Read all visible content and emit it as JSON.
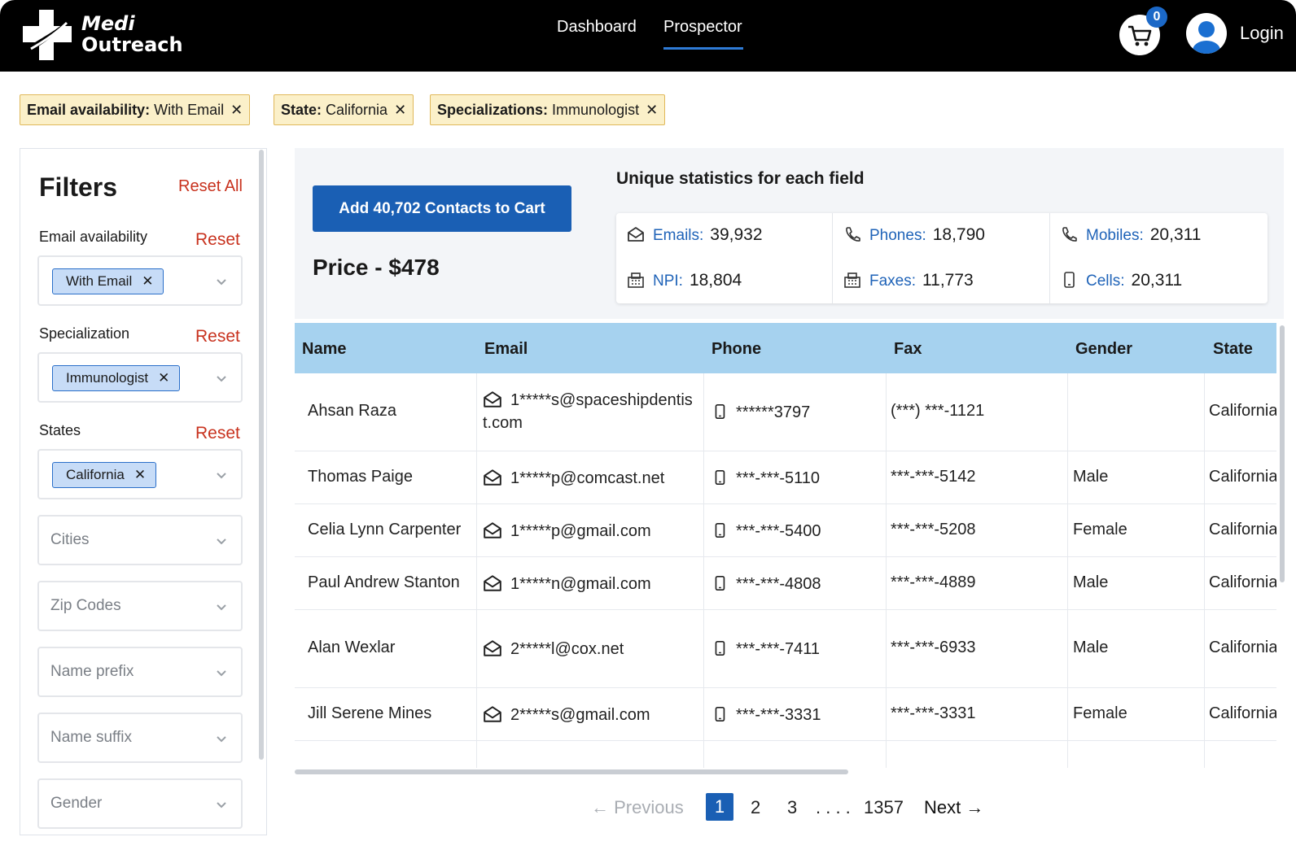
{
  "header": {
    "logo_line1": "Medi",
    "logo_line2": "Outreach",
    "nav": [
      "Dashboard",
      "Prospector"
    ],
    "active_nav": "Prospector",
    "cart_count": "0",
    "login_label": "Login"
  },
  "chips": [
    {
      "key": "Email availability:",
      "value": " With Email"
    },
    {
      "key": "State:",
      "value": " California"
    },
    {
      "key": "Specializations:",
      "value": " Immunologist"
    }
  ],
  "sidebar": {
    "title": "Filters",
    "reset_all": "Reset All",
    "reset_label": "Reset",
    "email_label": "Email availability",
    "email_tag": "With Email",
    "spec_label": "Specialization",
    "spec_tag": "Immunologist",
    "states_label": "States",
    "states_tag": "California",
    "placeholders": [
      "Cities",
      "Zip Codes",
      "Name prefix",
      "Name suffix",
      "Gender"
    ]
  },
  "summary": {
    "add_button": "Add 40,702 Contacts to Cart",
    "price": "Price - $478",
    "stats_title": "Unique statistics for each field",
    "stats": [
      {
        "label": "Emails:",
        "value": "39,932",
        "icon": "envelope-icon"
      },
      {
        "label": "Phones:",
        "value": "18,790",
        "icon": "phone-icon"
      },
      {
        "label": "Mobiles:",
        "value": "20,311",
        "icon": "phone-icon"
      },
      {
        "label": "NPI:",
        "value": "18,804",
        "icon": "fax-icon"
      },
      {
        "label": "Faxes:",
        "value": "11,773",
        "icon": "fax-icon"
      },
      {
        "label": "Cells:",
        "value": "20,311",
        "icon": "mobile-icon"
      }
    ]
  },
  "table": {
    "columns": [
      "Name",
      "Email",
      "Phone",
      "Fax",
      "Gender",
      "State"
    ],
    "rows": [
      {
        "name": "Ahsan Raza",
        "email_l1": "1*****s@spaceshipdentis",
        "email_l2": "t.com",
        "phone": "******3797",
        "fax": "(***) ***-1121",
        "gender": "",
        "state": "California"
      },
      {
        "name": "Thomas Paige",
        "email_l1": "1*****p@comcast.net",
        "email_l2": "",
        "phone": "***-***-5110",
        "fax": "***-***-5142",
        "gender": "Male",
        "state": "California"
      },
      {
        "name": "Celia Lynn Carpenter",
        "email_l1": "1*****p@gmail.com",
        "email_l2": "",
        "phone": "***-***-5400",
        "fax": "***-***-5208",
        "gender": "Female",
        "state": "California"
      },
      {
        "name": "Paul Andrew Stanton",
        "email_l1": "1*****n@gmail.com",
        "email_l2": "",
        "phone": "***-***-4808",
        "fax": "***-***-4889",
        "gender": "Male",
        "state": "California"
      },
      {
        "name": "Alan Wexlar",
        "email_l1": "2*****l@cox.net",
        "email_l2": "",
        "phone": "***-***-7411",
        "fax": "***-***-6933",
        "gender": "Male",
        "state": "California"
      },
      {
        "name": "Jill Serene Mines",
        "email_l1": "2*****s@gmail.com",
        "email_l2": "",
        "phone": "***-***-3331",
        "fax": "***-***-3331",
        "gender": "Female",
        "state": "California"
      }
    ]
  },
  "pagination": {
    "previous": "Previous",
    "pages": [
      "1",
      "2",
      "3"
    ],
    "ellipsis": ". . . .",
    "last": "1357",
    "next": "Next",
    "current": "1"
  },
  "colors": {
    "brand_blue": "#1a5fb4",
    "header_bg": "#000000",
    "table_header_bg": "#a6d2ef",
    "chip_bg": "#fbf0c9",
    "reset_red": "#c8321e"
  }
}
